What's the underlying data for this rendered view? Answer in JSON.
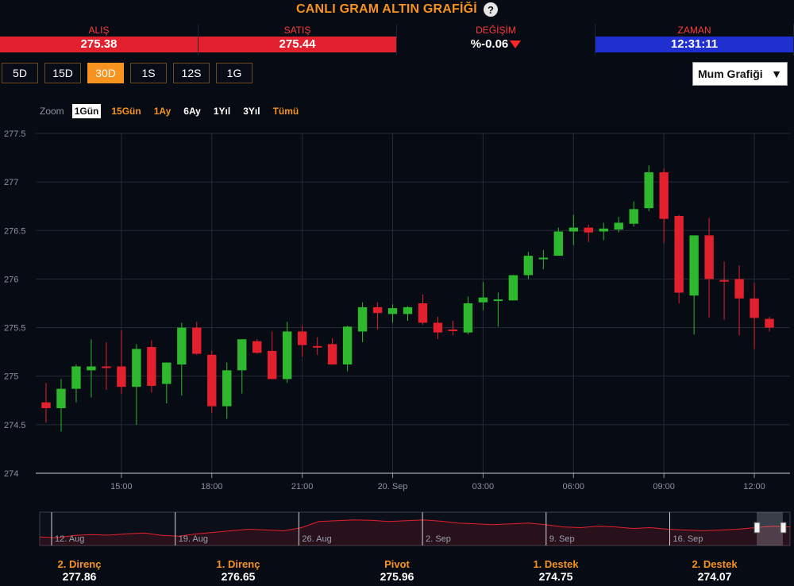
{
  "header": {
    "title": "CANLI GRAM ALTIN GRAFİĞİ",
    "help_icon": "?"
  },
  "quotes": [
    {
      "label": "ALIŞ",
      "value": "275.38",
      "style": "red"
    },
    {
      "label": "SATIŞ",
      "value": "275.44",
      "style": "red"
    },
    {
      "label": "DEĞİŞİM",
      "value": "%-0.06",
      "style": "plain"
    },
    {
      "label": "ZAMAN",
      "value": "12:31:11",
      "style": "blue"
    }
  ],
  "range_buttons": [
    "5D",
    "15D",
    "30D",
    "1S",
    "12S",
    "1G"
  ],
  "active_range": "30D",
  "chart_type_select": {
    "value": "Mum Grafiği"
  },
  "zoom": {
    "label": "Zoom",
    "options": [
      "1Gün",
      "15Gün",
      "1Ay",
      "6Ay",
      "1Yıl",
      "3Yıl",
      "Tümü"
    ],
    "active": "1Gün"
  },
  "chart_data": {
    "type": "candlestick",
    "y_ticks": [
      274,
      274.5,
      275,
      275.5,
      276,
      276.5,
      277,
      277.5
    ],
    "ylim": [
      274,
      277.5
    ],
    "x_ticks": [
      "15:00",
      "18:00",
      "21:00",
      "20. Sep",
      "03:00",
      "06:00",
      "09:00",
      "12:00"
    ],
    "candles": [
      {
        "o": 274.73,
        "h": 274.93,
        "l": 274.52,
        "c": 274.67
      },
      {
        "o": 274.67,
        "h": 274.97,
        "l": 274.43,
        "c": 274.87
      },
      {
        "o": 274.87,
        "h": 275.12,
        "l": 274.73,
        "c": 275.1
      },
      {
        "o": 275.06,
        "h": 275.38,
        "l": 274.78,
        "c": 275.1
      },
      {
        "o": 275.1,
        "h": 275.35,
        "l": 274.86,
        "c": 275.09
      },
      {
        "o": 275.1,
        "h": 275.47,
        "l": 274.82,
        "c": 274.89
      },
      {
        "o": 274.89,
        "h": 275.33,
        "l": 274.5,
        "c": 275.28
      },
      {
        "o": 275.3,
        "h": 275.37,
        "l": 274.83,
        "c": 274.9
      },
      {
        "o": 274.92,
        "h": 275.14,
        "l": 274.72,
        "c": 275.14
      },
      {
        "o": 275.12,
        "h": 275.55,
        "l": 274.8,
        "c": 275.5
      },
      {
        "o": 275.5,
        "h": 275.56,
        "l": 275.22,
        "c": 275.23
      },
      {
        "o": 275.22,
        "h": 275.26,
        "l": 274.62,
        "c": 274.69
      },
      {
        "o": 274.69,
        "h": 275.14,
        "l": 274.56,
        "c": 275.06
      },
      {
        "o": 275.06,
        "h": 275.38,
        "l": 274.82,
        "c": 275.38
      },
      {
        "o": 275.36,
        "h": 275.38,
        "l": 275.23,
        "c": 275.24
      },
      {
        "o": 275.26,
        "h": 275.46,
        "l": 274.97,
        "c": 274.97
      },
      {
        "o": 274.97,
        "h": 275.56,
        "l": 274.93,
        "c": 275.46
      },
      {
        "o": 275.46,
        "h": 275.52,
        "l": 275.2,
        "c": 275.32
      },
      {
        "o": 275.31,
        "h": 275.4,
        "l": 275.22,
        "c": 275.3
      },
      {
        "o": 275.33,
        "h": 275.39,
        "l": 275.12,
        "c": 275.12
      },
      {
        "o": 275.12,
        "h": 275.52,
        "l": 275.05,
        "c": 275.51
      },
      {
        "o": 275.46,
        "h": 275.76,
        "l": 275.35,
        "c": 275.71
      },
      {
        "o": 275.71,
        "h": 275.76,
        "l": 275.48,
        "c": 275.65
      },
      {
        "o": 275.64,
        "h": 275.74,
        "l": 275.55,
        "c": 275.7
      },
      {
        "o": 275.64,
        "h": 275.72,
        "l": 275.57,
        "c": 275.71
      },
      {
        "o": 275.75,
        "h": 275.84,
        "l": 275.53,
        "c": 275.55
      },
      {
        "o": 275.55,
        "h": 275.61,
        "l": 275.38,
        "c": 275.45
      },
      {
        "o": 275.48,
        "h": 275.57,
        "l": 275.42,
        "c": 275.47
      },
      {
        "o": 275.45,
        "h": 275.82,
        "l": 275.43,
        "c": 275.75
      },
      {
        "o": 275.76,
        "h": 275.97,
        "l": 275.68,
        "c": 275.81
      },
      {
        "o": 275.79,
        "h": 275.86,
        "l": 275.51,
        "c": 275.79
      },
      {
        "o": 275.78,
        "h": 276.04,
        "l": 275.78,
        "c": 276.04
      },
      {
        "o": 276.04,
        "h": 276.28,
        "l": 276.0,
        "c": 276.24
      },
      {
        "o": 276.22,
        "h": 276.3,
        "l": 276.1,
        "c": 276.22
      },
      {
        "o": 276.24,
        "h": 276.53,
        "l": 276.24,
        "c": 276.49
      },
      {
        "o": 276.49,
        "h": 276.66,
        "l": 276.35,
        "c": 276.53
      },
      {
        "o": 276.53,
        "h": 276.56,
        "l": 276.38,
        "c": 276.48
      },
      {
        "o": 276.49,
        "h": 276.58,
        "l": 276.4,
        "c": 276.52
      },
      {
        "o": 276.51,
        "h": 276.64,
        "l": 276.48,
        "c": 276.58
      },
      {
        "o": 276.57,
        "h": 276.8,
        "l": 276.54,
        "c": 276.72
      },
      {
        "o": 276.73,
        "h": 277.17,
        "l": 276.7,
        "c": 277.1
      },
      {
        "o": 277.1,
        "h": 277.14,
        "l": 276.37,
        "c": 276.62
      },
      {
        "o": 276.65,
        "h": 276.66,
        "l": 275.75,
        "c": 275.86
      },
      {
        "o": 275.83,
        "h": 276.45,
        "l": 275.43,
        "c": 276.45
      },
      {
        "o": 276.45,
        "h": 276.63,
        "l": 275.6,
        "c": 276.0
      },
      {
        "o": 275.99,
        "h": 276.18,
        "l": 275.58,
        "c": 275.98
      },
      {
        "o": 276.0,
        "h": 276.14,
        "l": 275.42,
        "c": 275.8
      },
      {
        "o": 275.8,
        "h": 275.96,
        "l": 275.28,
        "c": 275.6
      },
      {
        "o": 275.59,
        "h": 275.61,
        "l": 275.46,
        "c": 275.5
      }
    ]
  },
  "navigator": {
    "date_labels": [
      "12. Aug",
      "19. Aug",
      "26. Aug",
      "2. Sep",
      "9. Sep",
      "16. Sep"
    ],
    "series": [
      274.6,
      274.55,
      274.7,
      274.75,
      274.72,
      274.8,
      274.85,
      274.7,
      274.65,
      274.8,
      274.9,
      275.0,
      275.1,
      275.05,
      275.0,
      275.2,
      275.6,
      275.65,
      275.7,
      275.68,
      275.6,
      275.65,
      275.7,
      275.62,
      275.5,
      275.45,
      275.4,
      275.45,
      275.5,
      275.4,
      275.25,
      275.2,
      275.3,
      275.25,
      275.15,
      275.2,
      275.1,
      275.05,
      275.0,
      275.05,
      275.1,
      275.2,
      275.3,
      275.25
    ]
  },
  "levels": [
    {
      "name": "2. Direnç",
      "value": "277.86"
    },
    {
      "name": "1. Direnç",
      "value": "276.65"
    },
    {
      "name": "Pivot",
      "value": "275.96"
    },
    {
      "name": "1. Destek",
      "value": "274.75"
    },
    {
      "name": "2. Destek",
      "value": "274.07"
    }
  ],
  "colors": {
    "up": "#2eb82e",
    "down": "#e3202d",
    "accent": "#f7931e",
    "background": "#070b14",
    "grid": "#262b36"
  }
}
